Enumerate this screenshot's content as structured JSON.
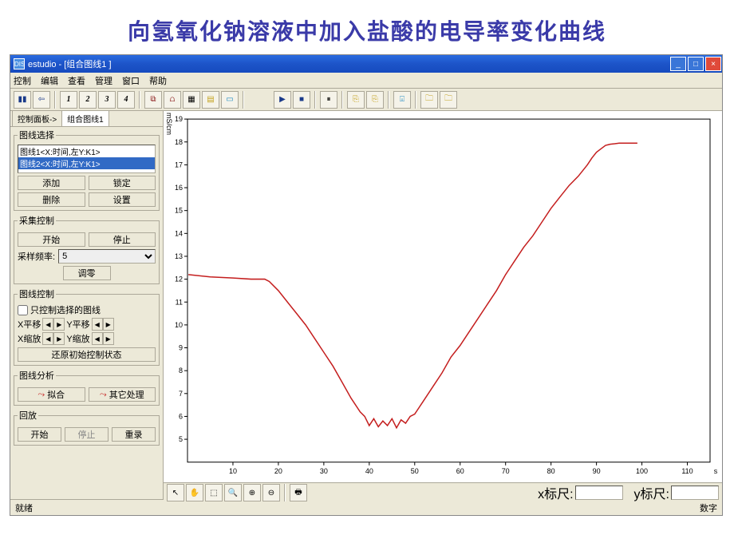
{
  "slide_title": "向氢氧化钠溶液中加入盐酸的电导率变化曲线",
  "window": {
    "app_icon": "DIS",
    "title": "estudio - [组合图线1 ]",
    "min": "_",
    "max": "□",
    "close": "×"
  },
  "menu": [
    "控制",
    "编辑",
    "查看",
    "管理",
    "窗口",
    "帮助"
  ],
  "toolbar": {
    "nums": [
      "1",
      "2",
      "3",
      "4"
    ]
  },
  "sidebar": {
    "tabs": {
      "tab1": "控制面板->",
      "tab2": "组合图线1"
    },
    "curve_select": {
      "legend": "图线选择",
      "items": [
        "图线1<X:时间,左Y:K1>",
        "图线2<X:时间,左Y:K1>"
      ],
      "add": "添加",
      "lock": "锁定",
      "delete": "删除",
      "settings": "设置"
    },
    "acquire": {
      "legend": "采集控制",
      "start": "开始",
      "stop": "停止",
      "rate_label": "采样频率:",
      "rate_value": "5",
      "zero": "调零"
    },
    "curve_ctrl": {
      "legend": "图线控制",
      "only_selected": "只控制选择的图线",
      "xshift": "X平移",
      "yshift": "Y平移",
      "xzoom": "X缩放",
      "yzoom": "Y缩放",
      "restore": "还原初始控制状态"
    },
    "analysis": {
      "legend": "图线分析",
      "fit": "拟合",
      "other": "其它处理"
    },
    "playback": {
      "legend": "回放",
      "start": "开始",
      "stop": "停止",
      "rerecord": "重录"
    }
  },
  "chart": {
    "ylabel": "mS/cm",
    "xaxis": "s",
    "x_ruler_label": "x标尺:",
    "y_ruler_label": "y标尺:"
  },
  "status": {
    "left": "就绪",
    "right": "数字"
  },
  "chart_data": {
    "type": "line",
    "xlabel": "s",
    "ylabel": "mS/cm",
    "xlim": [
      0,
      115
    ],
    "ylim": [
      4,
      19
    ],
    "x_ticks": [
      10,
      20,
      30,
      40,
      50,
      60,
      70,
      80,
      90,
      100,
      110
    ],
    "y_ticks": [
      5,
      6,
      7,
      8,
      9,
      10,
      11,
      12,
      13,
      14,
      15,
      16,
      17,
      18,
      19
    ],
    "series": [
      {
        "name": "K1",
        "data": [
          [
            0.2,
            12.2
          ],
          [
            5,
            12.1
          ],
          [
            10,
            12.05
          ],
          [
            14,
            12.0
          ],
          [
            17,
            12.0
          ],
          [
            18,
            11.9
          ],
          [
            19,
            11.7
          ],
          [
            20,
            11.5
          ],
          [
            22,
            11.0
          ],
          [
            24,
            10.5
          ],
          [
            26,
            10.0
          ],
          [
            28,
            9.4
          ],
          [
            30,
            8.8
          ],
          [
            32,
            8.2
          ],
          [
            34,
            7.5
          ],
          [
            36,
            6.8
          ],
          [
            38,
            6.2
          ],
          [
            39,
            6.0
          ],
          [
            40,
            5.6
          ],
          [
            41,
            5.9
          ],
          [
            42,
            5.55
          ],
          [
            43,
            5.8
          ],
          [
            44,
            5.6
          ],
          [
            45,
            5.9
          ],
          [
            46,
            5.5
          ],
          [
            47,
            5.85
          ],
          [
            48,
            5.7
          ],
          [
            49,
            6.0
          ],
          [
            50,
            6.1
          ],
          [
            51,
            6.4
          ],
          [
            52,
            6.7
          ],
          [
            54,
            7.3
          ],
          [
            56,
            7.9
          ],
          [
            58,
            8.6
          ],
          [
            60,
            9.1
          ],
          [
            62,
            9.7
          ],
          [
            64,
            10.3
          ],
          [
            66,
            10.9
          ],
          [
            68,
            11.5
          ],
          [
            70,
            12.2
          ],
          [
            72,
            12.8
          ],
          [
            74,
            13.4
          ],
          [
            76,
            13.9
          ],
          [
            78,
            14.5
          ],
          [
            80,
            15.1
          ],
          [
            82,
            15.6
          ],
          [
            84,
            16.1
          ],
          [
            86,
            16.5
          ],
          [
            88,
            17.0
          ],
          [
            89,
            17.3
          ],
          [
            90,
            17.55
          ],
          [
            91,
            17.7
          ],
          [
            92,
            17.85
          ],
          [
            93,
            17.9
          ],
          [
            94,
            17.92
          ],
          [
            95,
            17.95
          ],
          [
            96,
            17.95
          ],
          [
            97,
            17.95
          ],
          [
            99,
            17.95
          ]
        ]
      }
    ]
  }
}
